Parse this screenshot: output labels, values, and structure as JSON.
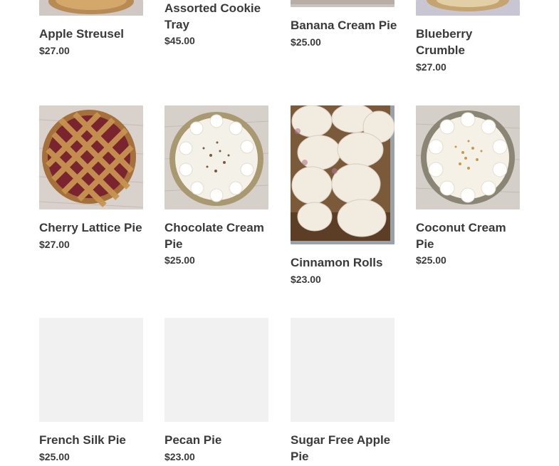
{
  "products": [
    {
      "id": "apple-streusel",
      "title": "Apple Streusel",
      "price": "$27.00"
    },
    {
      "id": "assorted-cookie-tray",
      "title": "Assorted Cookie Tray",
      "price": "$45.00"
    },
    {
      "id": "banana-cream-pie",
      "title": "Banana Cream Pie",
      "price": "$25.00"
    },
    {
      "id": "blueberry-crumble",
      "title": "Blueberry Crumble",
      "price": "$27.00"
    },
    {
      "id": "cherry-lattice-pie",
      "title": "Cherry Lattice Pie",
      "price": "$27.00"
    },
    {
      "id": "chocolate-cream-pie",
      "title": "Chocolate Cream Pie",
      "price": "$25.00"
    },
    {
      "id": "cinnamon-rolls",
      "title": "Cinnamon Rolls",
      "price": "$23.00"
    },
    {
      "id": "coconut-cream-pie",
      "title": "Coconut Cream Pie",
      "price": "$25.00"
    },
    {
      "id": "french-silk-pie",
      "title": "French Silk Pie",
      "price": "$25.00"
    },
    {
      "id": "pecan-pie",
      "title": "Pecan Pie",
      "price": "$23.00"
    },
    {
      "id": "sugar-free-apple-pie",
      "title": "Sugar Free Apple Pie",
      "price": ""
    }
  ]
}
